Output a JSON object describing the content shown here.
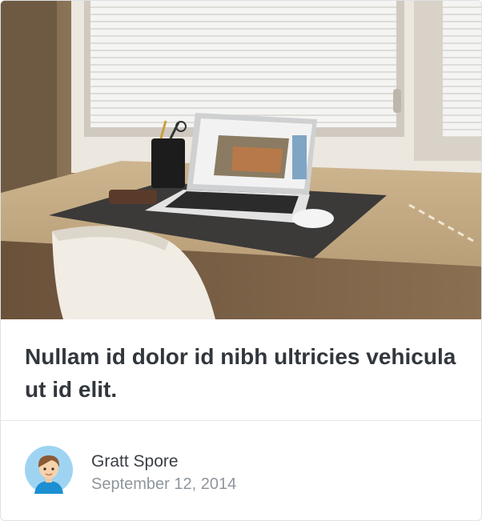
{
  "post": {
    "title": "Nullam id dolor id nibh ultricies vehicula ut id elit.",
    "image": "desk-laptop-window-photo",
    "author": {
      "name": "Gratt Spore",
      "date": "September 12, 2014",
      "avatar": "boy-avatar-icon"
    }
  }
}
